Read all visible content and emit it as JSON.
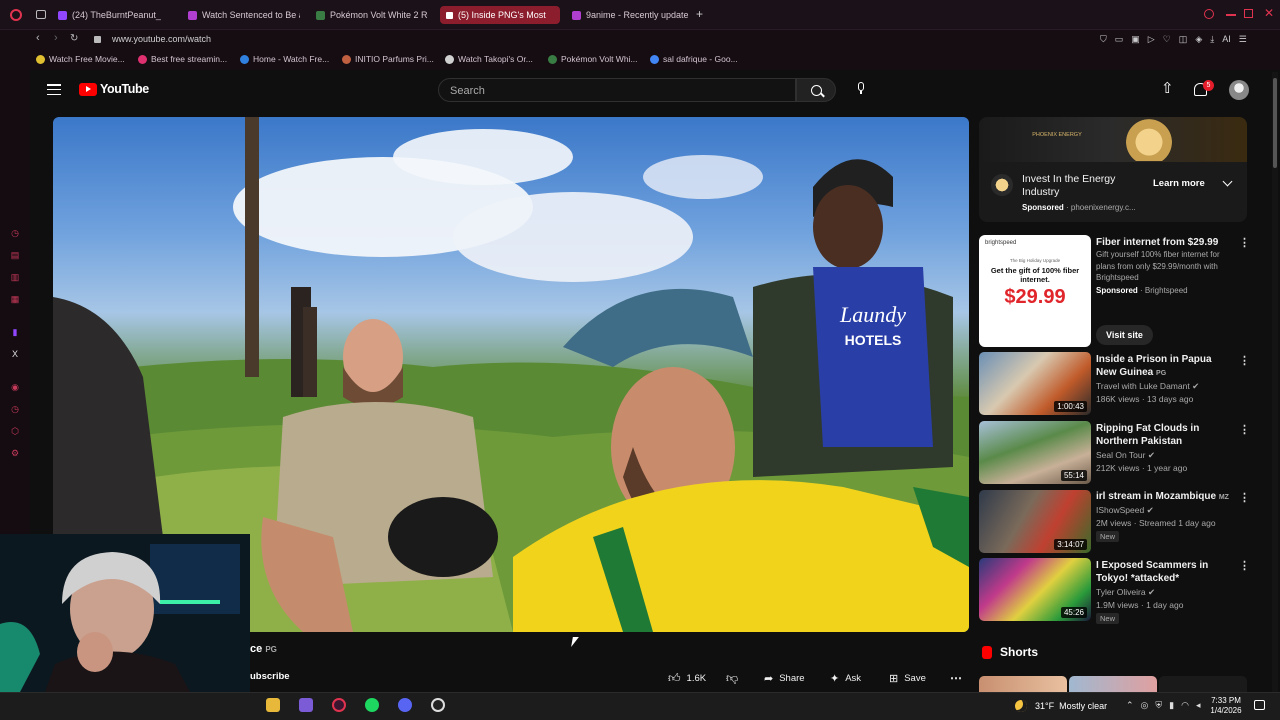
{
  "browser": {
    "tabs": [
      {
        "label": "(24) TheBurntPeanut_",
        "color": "#9146ff"
      },
      {
        "label": "Watch Sentenced to Be a",
        "color": "#b03fd0"
      },
      {
        "label": "Pokémon Volt White 2 Re",
        "color": "#3a7d44"
      },
      {
        "label": "(5) Inside PNG's Most",
        "color": "#ff0000"
      },
      {
        "label": "9anime - Recently update",
        "color": "#b03fd0"
      }
    ],
    "active_tab_index": 3,
    "url": "www.youtube.com/watch",
    "bookmarks": [
      {
        "label": "Watch Free Movie...",
        "color": "#e0c030"
      },
      {
        "label": "Best free streamin...",
        "color": "#e03070"
      },
      {
        "label": "Home - Watch Fre...",
        "color": "#3080e0"
      },
      {
        "label": "INITIO Parfums Pri...",
        "color": "#c06040"
      },
      {
        "label": "Watch Takopi's Or...",
        "color": "#d0d0d0"
      },
      {
        "label": "Pokémon Volt Whi...",
        "color": "#3a7d44"
      },
      {
        "label": "sal dafrique - Goo...",
        "color": "#4285f4"
      }
    ],
    "extension_text": "AI"
  },
  "youtube": {
    "logo_text": "YouTube",
    "search_placeholder": "Search",
    "notification_count": "5",
    "video": {
      "title_fragment": "ce",
      "rating": "PG",
      "subscribe_label": "ubscribe",
      "like_count": "1.6K",
      "share_label": "Share",
      "ask_label": "Ask",
      "save_label": "Save"
    },
    "ad": {
      "brand_logo": "PHOENIX ENERGY",
      "title": "Invest In the Energy Industry",
      "sponsored": "Sponsored",
      "domain": "phoenixenergy.c...",
      "cta": "Learn more"
    },
    "promo": {
      "thumb_brand": "brightspeed",
      "thumb_small": "The Big Holiday Upgrade",
      "thumb_headline": "Get the gift of 100% fiber internet.",
      "thumb_price": "$29.99",
      "title": "Fiber internet from $29.99",
      "desc": "Gift yourself 100% fiber internet for plans from only $29.99/month with Brightspeed",
      "sponsored": "Sponsored",
      "advertiser": "Brightspeed",
      "cta": "Visit site"
    },
    "recommendations": [
      {
        "title": "Inside a Prison in Papua New Guinea",
        "rating": "PG",
        "channel": "Travel with Luke Damant",
        "views": "186K views",
        "age": "13 days ago",
        "duration": "1:00:43",
        "badge": ""
      },
      {
        "title": "Ripping Fat Clouds in Northern Pakistan",
        "rating": "",
        "channel": "Seal On Tour",
        "views": "212K views",
        "age": "1 year ago",
        "duration": "55:14",
        "badge": ""
      },
      {
        "title": "irl stream in Mozambique",
        "rating": "MZ",
        "channel": "IShowSpeed",
        "views": "2M views",
        "age": "Streamed 1 day ago",
        "duration": "3:14:07",
        "badge": "New"
      },
      {
        "title": "I Exposed Scammers in Tokyo! *attacked*",
        "rating": "",
        "channel": "Tyler Oliveira",
        "views": "1.9M views",
        "age": "1 day ago",
        "duration": "45:26",
        "badge": "New"
      }
    ],
    "shorts_label": "Shorts"
  },
  "taskbar": {
    "weather": "31°F  Mostly clear",
    "time": "7:33 PM",
    "date": "1/4/2026"
  }
}
